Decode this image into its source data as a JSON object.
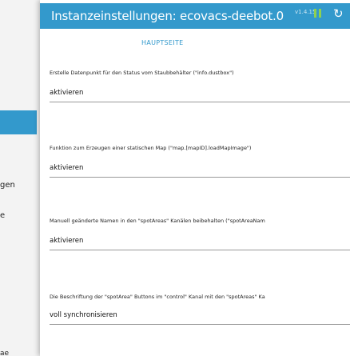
{
  "background": {
    "text_1": "gen",
    "text_2": "e",
    "text_3": "ae"
  },
  "dialog": {
    "title": "Instanzeinstellungen: ecovacs-deebot.0",
    "version": "v1.4.15",
    "tab_label": "HAUPTSEITE",
    "accent_color": "#3399cc"
  },
  "settings": [
    {
      "label": "Erstelle Datenpunkt für den Status vom Staubbehälter (\"info.dustbox\")",
      "value": "aktivieren"
    },
    {
      "label": "Funktion zum Erzeugen einer statischen Map (\"map.[mapID].loadMapImage\")",
      "value": "aktivieren"
    },
    {
      "label": "Manuell geänderte Namen in den \"spotAreas\" Kanälen beibehalten (\"spotAreaNam",
      "value": "aktivieren"
    },
    {
      "label": "Die Beschriftung der \"spotArea\" Buttons im \"control\" Kanal mit den \"spotAreas\" Ka",
      "value": "voll synchronisieren"
    }
  ]
}
